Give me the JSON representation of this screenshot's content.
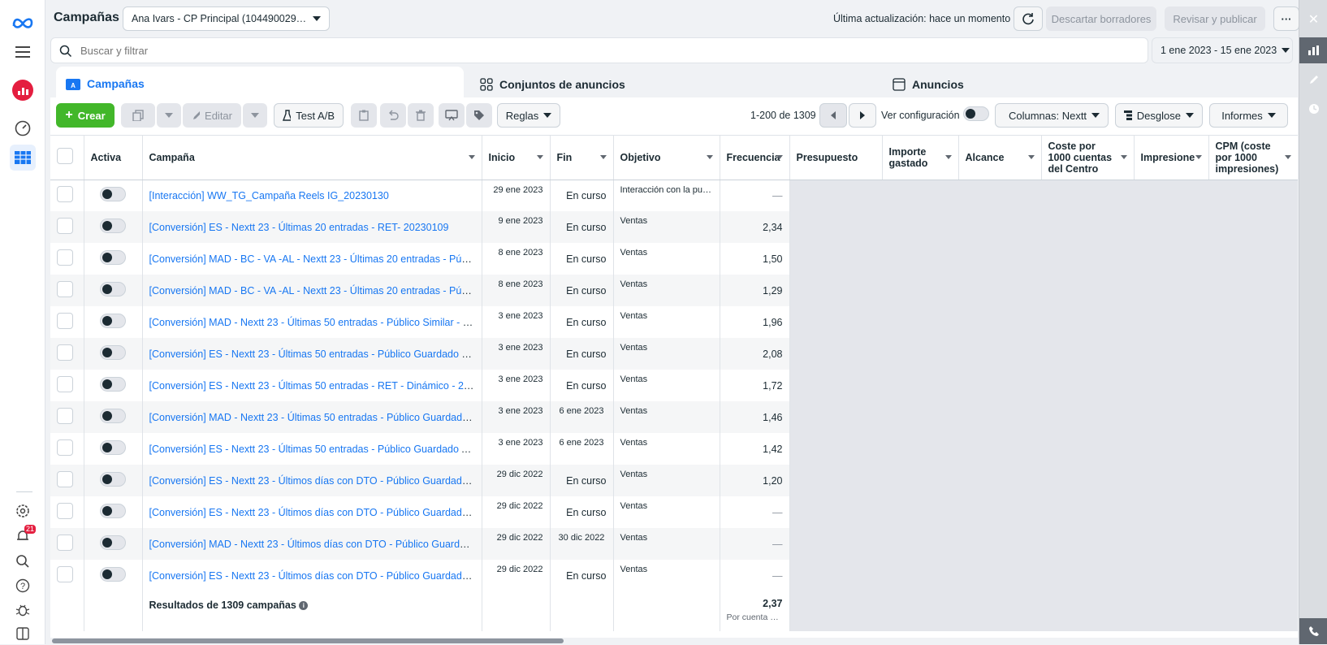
{
  "header": {
    "title": "Campañas",
    "account": "Ana Ivars - CP Principal (1044900299...",
    "last_update": "Última actualización: hace un momento",
    "discard": "Descartar borradores",
    "review": "Revisar y publicar",
    "more": "···"
  },
  "search": {
    "placeholder": "Buscar y filtrar",
    "date_range": "1 ene 2023 - 15 ene 2023"
  },
  "tabs": {
    "campaigns": "Campañas",
    "adsets": "Conjuntos de anuncios",
    "ads": "Anuncios"
  },
  "toolbar": {
    "create": "Crear",
    "edit": "Editar",
    "abtest": "Test A/B",
    "rules": "Reglas",
    "pagination": "1-200 de 1309",
    "view_settings": "Ver configuración",
    "columns": "Columnas: Nextt",
    "breakdown": "Desglose",
    "reports": "Informes"
  },
  "columns": [
    "Activa",
    "Campaña",
    "Inicio",
    "Fin",
    "Objetivo",
    "Frecuencia",
    "Presupuesto",
    "Importe gastado",
    "Alcance",
    "Coste por 1000 cuentas del Centro de...",
    "Impresione",
    "CPM (coste por 1000 impresiones)"
  ],
  "rows": [
    {
      "name": "[Interacción] WW_TG_Campaña Reels IG_20230130",
      "start": "29 ene 2023",
      "end": "En curso",
      "objective": "Interacción con la publ...",
      "freq": "—"
    },
    {
      "name": "[Conversión] ES - Nextt 23 - Últimas 20 entradas - RET- 20230109",
      "start": "9 ene 2023",
      "end": "En curso",
      "objective": "Ventas",
      "freq": "2,34"
    },
    {
      "name": "[Conversión] MAD - BC - VA -AL - Nextt 23 - Últimas 20 entradas - Público ...",
      "start": "8 ene 2023",
      "end": "En curso",
      "objective": "Ventas",
      "freq": "1,50"
    },
    {
      "name": "[Conversión] MAD - BC - VA -AL - Nextt 23 - Últimas 20 entradas - Público ...",
      "start": "8 ene 2023",
      "end": "En curso",
      "objective": "Ventas",
      "freq": "1,29"
    },
    {
      "name": "[Conversión] MAD - Nextt 23 - Últimas 50 entradas - Público Similar - 202...",
      "start": "3 ene 2023",
      "end": "En curso",
      "objective": "Ventas",
      "freq": "1,96"
    },
    {
      "name": "[Conversión] ES - Nextt 23 - Últimas 50 entradas - Público Guardado Carg...",
      "start": "3 ene 2023",
      "end": "En curso",
      "objective": "Ventas",
      "freq": "2,08"
    },
    {
      "name": "[Conversión] ES - Nextt 23 - Últimas 50 entradas - RET - Dinámico - 20230...",
      "start": "3 ene 2023",
      "end": "En curso",
      "objective": "Ventas",
      "freq": "1,72"
    },
    {
      "name": "[Conversión] MAD - Nextt 23 - Últimas 50 entradas - Público Guardado Av...",
      "start": "3 ene 2023",
      "end": "6 ene 2023",
      "objective": "Ventas",
      "freq": "1,46"
    },
    {
      "name": "[Conversión] ES - Nextt 23 - Últimas 50 entradas - Público Guardado Avat...",
      "start": "3 ene 2023",
      "end": "6 ene 2023",
      "objective": "Ventas",
      "freq": "1,42"
    },
    {
      "name": "[Conversión] ES - Nextt 23 - Últimos días con DTO - Público Guardado Ava...",
      "start": "29 dic 2022",
      "end": "En curso",
      "objective": "Ventas",
      "freq": "1,20"
    },
    {
      "name": "[Conversión] ES - Nextt 23 - Últimos días con DTO - Público Guardado Abi...",
      "start": "29 dic 2022",
      "end": "En curso",
      "objective": "Ventas",
      "freq": "—"
    },
    {
      "name": "[Conversión] MAD - Nextt 23 - Últimos días con DTO - Público Guardado A...",
      "start": "29 dic 2022",
      "end": "30 dic 2022",
      "objective": "Ventas",
      "freq": "—"
    },
    {
      "name": "[Conversión] ES - Nextt 23 - Últimos días con DTO - Público Guardado Abi...",
      "start": "29 dic 2022",
      "end": "En curso",
      "objective": "Ventas",
      "freq": "—"
    }
  ],
  "summary": {
    "label": "Resultados de 1309 campañas",
    "freq": "2,37",
    "freq_note": "Por cuenta de..."
  },
  "sidebar": {
    "notif_badge": "21"
  },
  "colors": {
    "brand": "#1877f2",
    "create": "#42b72a"
  }
}
